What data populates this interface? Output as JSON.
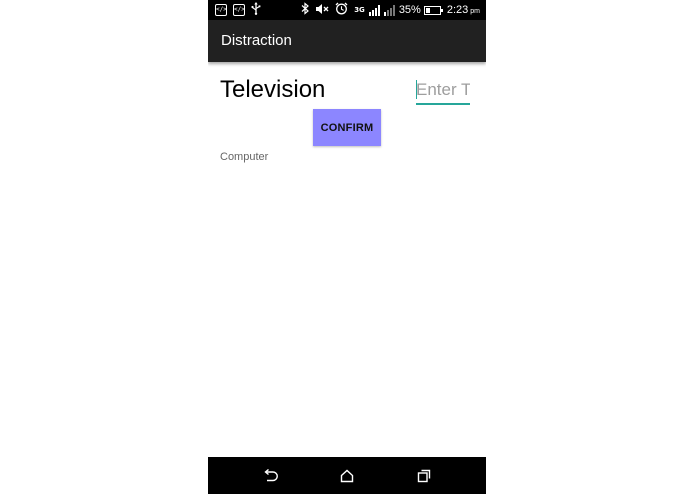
{
  "status_bar": {
    "battery_percent": "35%",
    "battery_level": 0.35,
    "time": "2:23",
    "ampm": "pm",
    "network_type": "3G",
    "left_icons": [
      "code-icon",
      "code-icon",
      "usb-icon"
    ],
    "right_icons": [
      "bluetooth-icon",
      "mute-icon",
      "alarm-icon",
      "network-3g-icon",
      "signal-icon",
      "signal-dim-icon",
      "battery-icon"
    ]
  },
  "app_bar": {
    "title": "Distraction"
  },
  "main": {
    "activity_label": "Television",
    "time_input": {
      "value": "",
      "placeholder": "Enter Ti"
    },
    "confirm_label": "CONFIRM",
    "next_activity": "Computer"
  },
  "nav_bar": {
    "buttons": [
      "back-icon",
      "home-icon",
      "recents-icon"
    ]
  },
  "colors": {
    "status_bar": "#000000",
    "app_bar": "#212121",
    "accent": "#26a69a",
    "confirm_button": "#8c86ff",
    "nav_bar": "#000000"
  }
}
